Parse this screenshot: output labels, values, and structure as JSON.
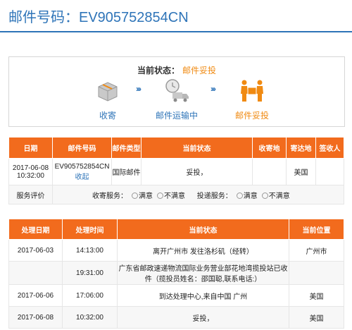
{
  "header": {
    "title": "邮件号码：EV905752854CN"
  },
  "status": {
    "label": "当前状态：",
    "value": "邮件妥投",
    "steps": [
      {
        "label": "收寄"
      },
      {
        "label": "邮件运输中"
      },
      {
        "label": "邮件妥投"
      }
    ],
    "arrow": "›››"
  },
  "summary_table": {
    "headers": [
      "日期",
      "邮件号码",
      "邮件类型",
      "当前状态",
      "收寄地",
      "寄达地",
      "签收人"
    ],
    "row": {
      "date": "2017-06-08 10:32:00",
      "mail_no": "EV905752854CN",
      "collapse": "收起",
      "type": "国际邮件",
      "status": "妥投，",
      "origin": "",
      "dest": "美国",
      "signer": ""
    },
    "rating": {
      "label": "服务评价",
      "collect_label": "收寄服务：",
      "deliver_label": "投递服务：",
      "good": "满意",
      "bad": "不满意"
    }
  },
  "tracking_table": {
    "headers": [
      "处理日期",
      "处理时间",
      "当前状态",
      "当前位置"
    ],
    "rows": [
      {
        "date": "2017-06-03",
        "time": "14:13:00",
        "status": "离开广州市 发往洛杉矶（经转）",
        "loc": "广州市"
      },
      {
        "date": "",
        "time": "19:31:00",
        "status": "广东省邮政速递物流国际业务营业部花地湾揽投站已收件（揽投员姓名：邵国聪,联系电话:）",
        "loc": ""
      },
      {
        "date": "2017-06-06",
        "time": "17:06:00",
        "status": "到达处理中心,来自中国 广州",
        "loc": "美国"
      },
      {
        "date": "2017-06-08",
        "time": "10:32:00",
        "status": "妥投，",
        "loc": "美国"
      }
    ]
  }
}
